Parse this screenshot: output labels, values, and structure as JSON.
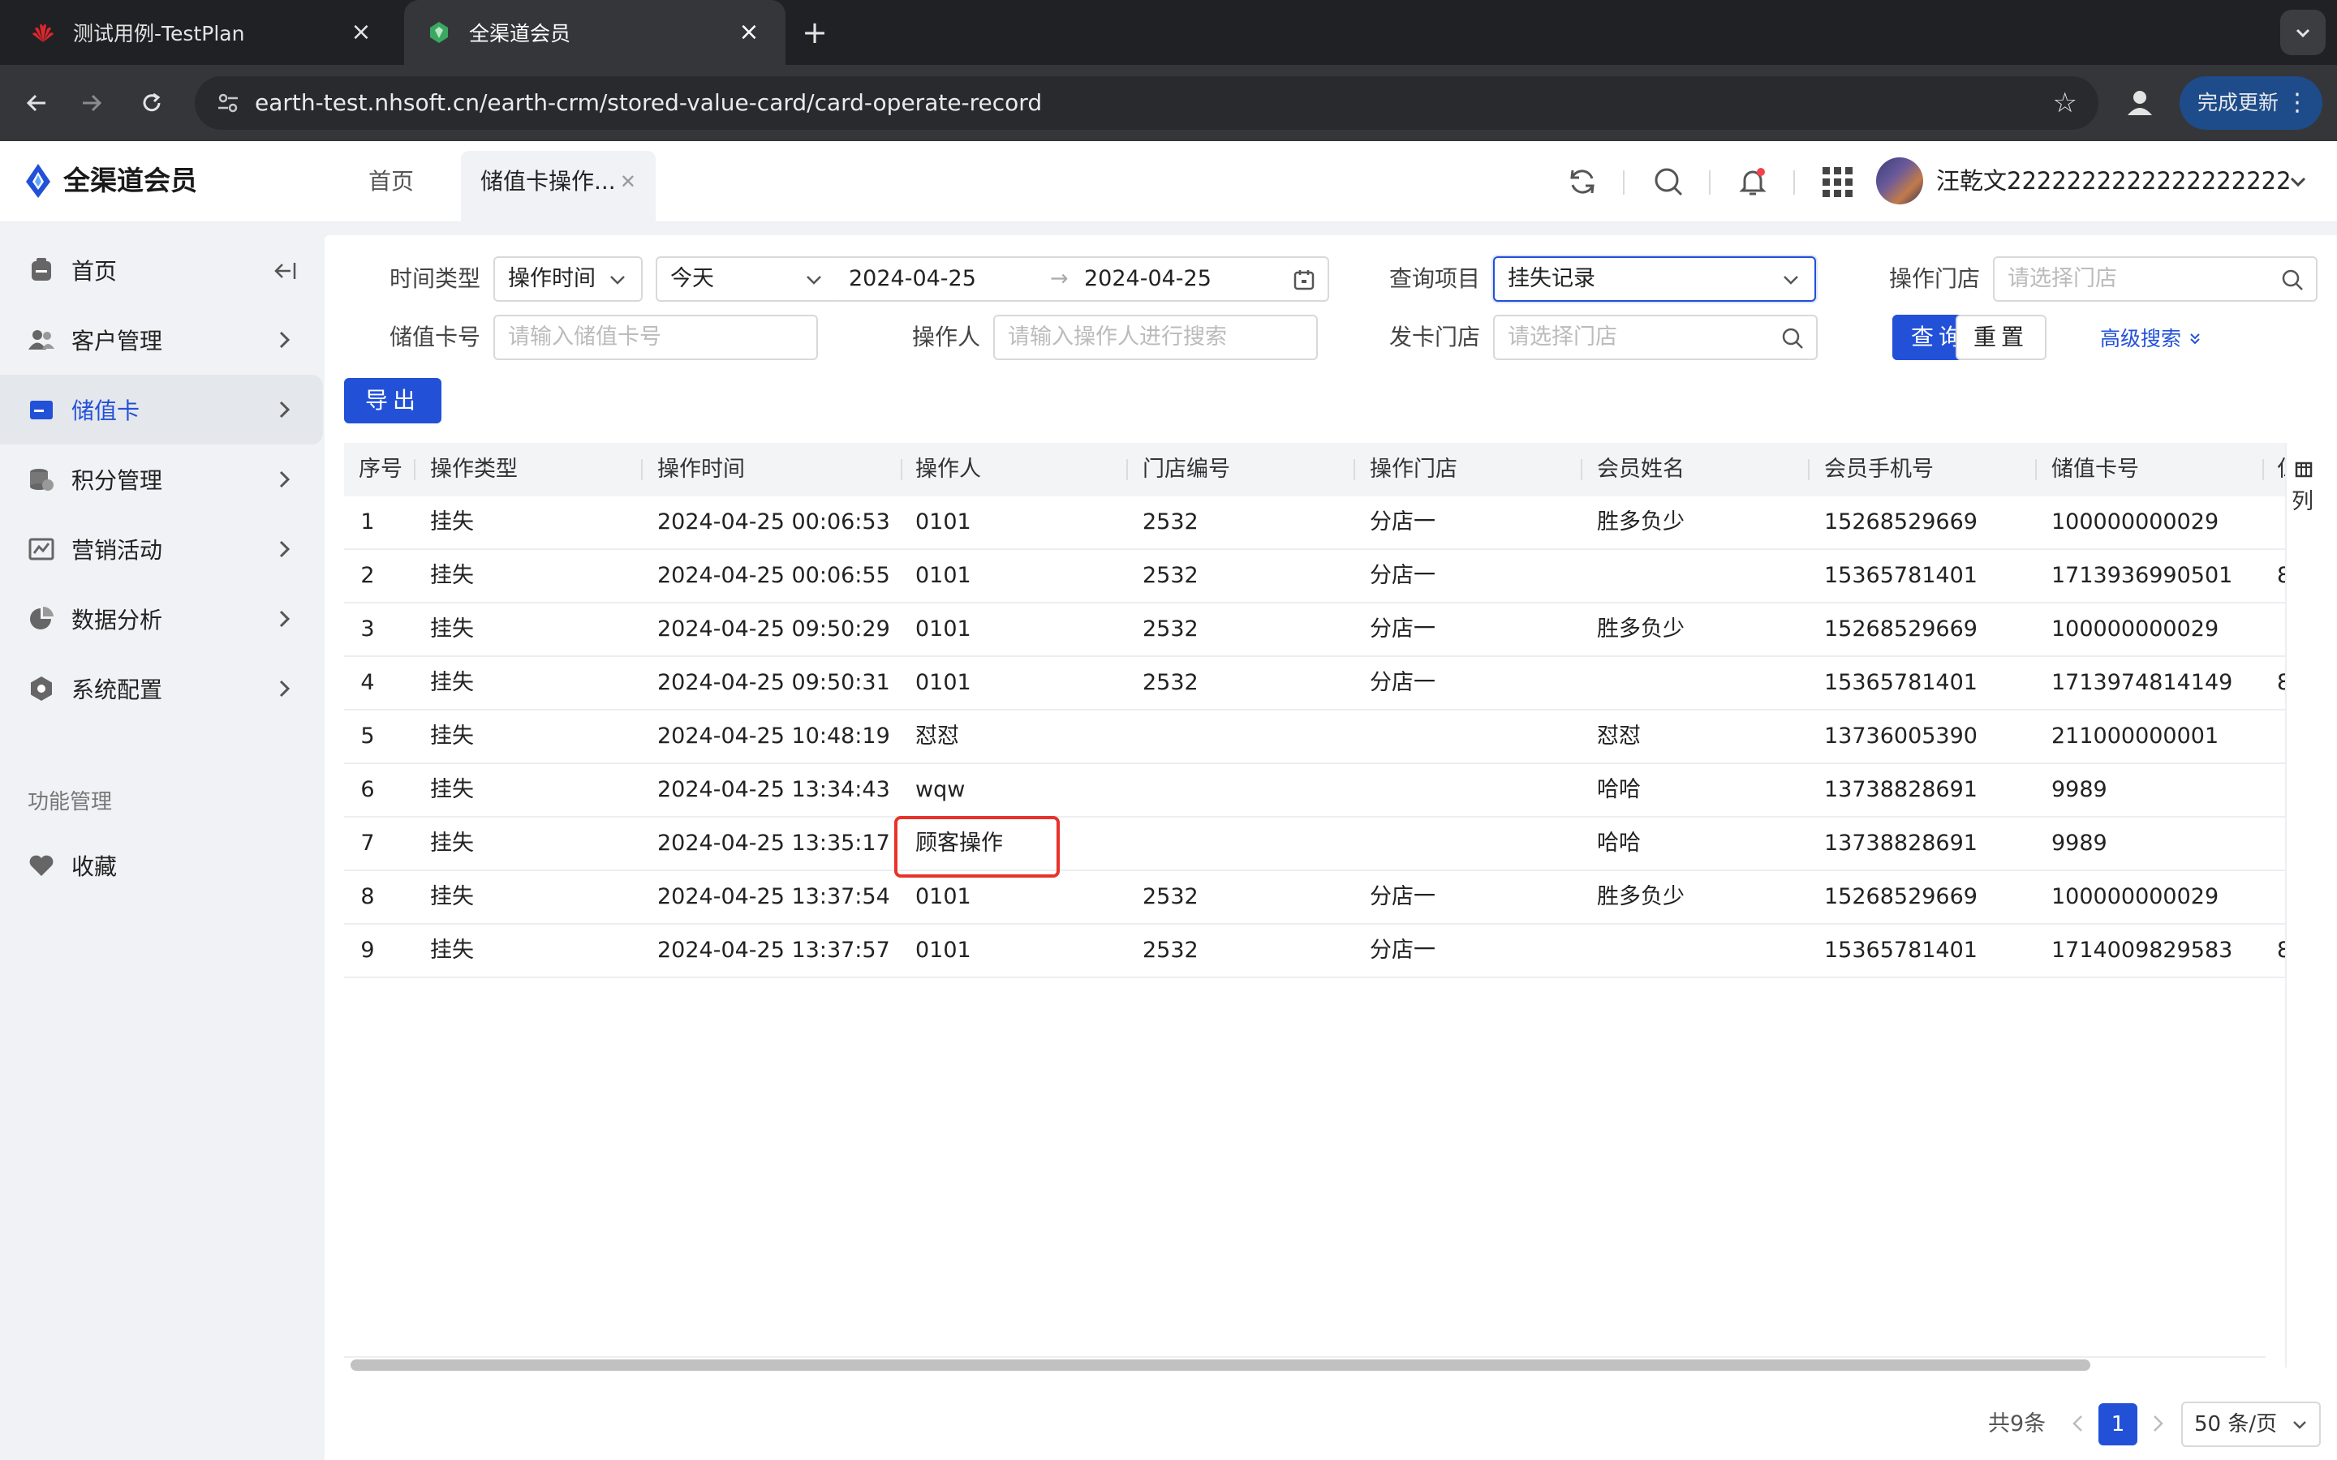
{
  "browser": {
    "tabs": [
      {
        "title": "测试用例-TestPlan",
        "active": false
      },
      {
        "title": "全渠道会员",
        "active": true
      }
    ],
    "url": "earth-test.nhsoft.cn/earth-crm/stored-value-card/card-operate-record",
    "update_label": "完成更新"
  },
  "app": {
    "name": "全渠道会员",
    "page_tabs": [
      {
        "label": "首页"
      },
      {
        "label": "储值卡操作..."
      }
    ],
    "user_name": "汪乾文2222222222222222222"
  },
  "sidebar": {
    "items": [
      {
        "label": "首页",
        "icon": "home-icon"
      },
      {
        "label": "客户管理",
        "icon": "users-icon"
      },
      {
        "label": "储值卡",
        "icon": "card-icon",
        "active": true
      },
      {
        "label": "积分管理",
        "icon": "coins-icon"
      },
      {
        "label": "营销活动",
        "icon": "chart-line-icon"
      },
      {
        "label": "数据分析",
        "icon": "pie-chart-icon"
      },
      {
        "label": "系统配置",
        "icon": "settings-hex-icon"
      }
    ],
    "section_title": "功能管理",
    "favorites_label": "收藏"
  },
  "filters": {
    "time_type_label": "时间类型",
    "time_type_value": "操作时间",
    "range_value": "今天",
    "date_start": "2024-04-25",
    "date_end": "2024-04-25",
    "query_item_label": "查询项目",
    "query_item_value": "挂失记录",
    "store_label": "操作门店",
    "store_placeholder": "请选择门店",
    "card_no_label": "储值卡号",
    "card_no_placeholder": "请输入储值卡号",
    "operator_label": "操作人",
    "operator_placeholder": "请输入操作人进行搜索",
    "issue_store_label": "发卡门店",
    "issue_store_placeholder": "请选择门店",
    "search_button": "查询",
    "reset_button": "重置",
    "advanced_search": "高级搜索",
    "export_button": "导出"
  },
  "table": {
    "columns": [
      "序号",
      "操作类型",
      "操作时间",
      "操作人",
      "门店编号",
      "操作门店",
      "会员姓名",
      "会员手机号",
      "储值卡号"
    ],
    "column_setting_label": "列",
    "rows": [
      [
        "1",
        "挂失",
        "2024-04-25 00:06:53",
        "0101",
        "2532",
        "分店一",
        "胜多负少",
        "15268529669",
        "100000000029"
      ],
      [
        "2",
        "挂失",
        "2024-04-25 00:06:55",
        "0101",
        "2532",
        "分店一",
        "",
        "15365781401",
        "1713936990501"
      ],
      [
        "3",
        "挂失",
        "2024-04-25 09:50:29",
        "0101",
        "2532",
        "分店一",
        "胜多负少",
        "15268529669",
        "100000000029"
      ],
      [
        "4",
        "挂失",
        "2024-04-25 09:50:31",
        "0101",
        "2532",
        "分店一",
        "",
        "15365781401",
        "1713974814149"
      ],
      [
        "5",
        "挂失",
        "2024-04-25 10:48:19",
        "怼怼",
        "",
        "",
        "怼怼",
        "13736005390",
        "211000000001"
      ],
      [
        "6",
        "挂失",
        "2024-04-25 13:34:43",
        "wqw",
        "",
        "",
        "哈哈",
        "13738828691",
        "9989"
      ],
      [
        "7",
        "挂失",
        "2024-04-25 13:35:17",
        "顾客操作",
        "",
        "",
        "哈哈",
        "13738828691",
        "9989"
      ],
      [
        "8",
        "挂失",
        "2024-04-25 13:37:54",
        "0101",
        "2532",
        "分店一",
        "胜多负少",
        "15268529669",
        "100000000029"
      ],
      [
        "9",
        "挂失",
        "2024-04-25 13:37:57",
        "0101",
        "2532",
        "分店一",
        "",
        "15365781401",
        "1714009829583"
      ]
    ],
    "cutoff_glyphs": [
      "",
      "8",
      "",
      "8",
      "",
      "",
      "",
      "",
      "8"
    ]
  },
  "pagination": {
    "total": "共9条",
    "current": "1",
    "page_size": "50 条/页"
  },
  "colors": {
    "primary": "#2251d8",
    "highlight": "#e8322a"
  }
}
